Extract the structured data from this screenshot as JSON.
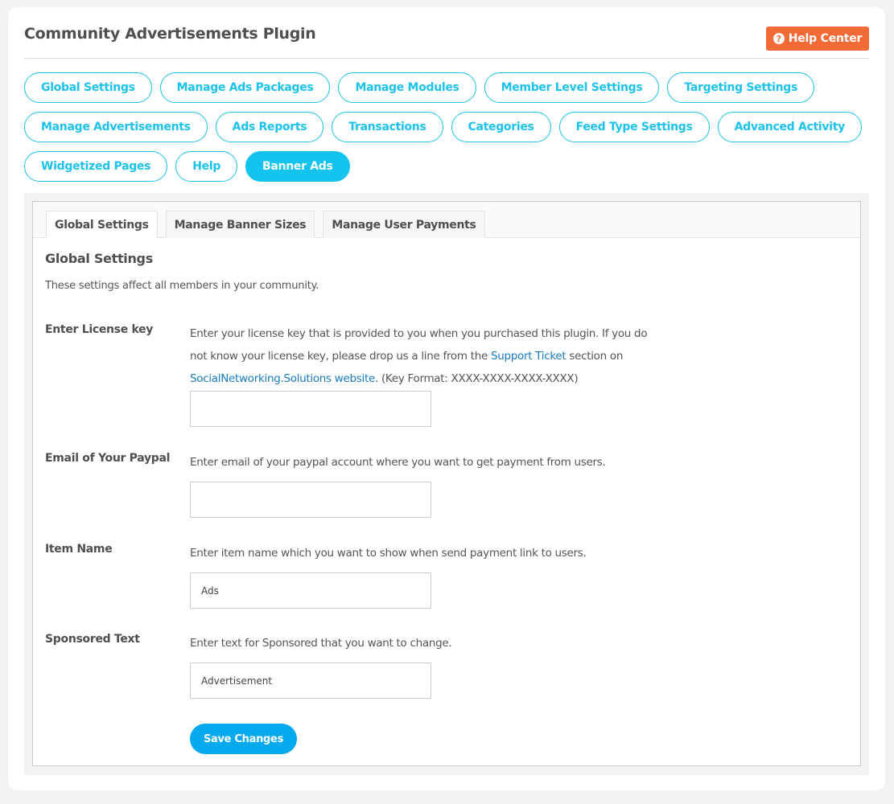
{
  "header": {
    "title": "Community Advertisements Plugin",
    "help_center_label": "Help Center",
    "help_center_icon": "question-circle-icon",
    "help_center_color": "#f26a35"
  },
  "nav": {
    "accent_color": "#1cc2eb",
    "rows": [
      [
        {
          "label": "Global Settings",
          "active": false
        },
        {
          "label": "Manage Ads Packages",
          "active": false
        },
        {
          "label": "Manage Modules",
          "active": false
        },
        {
          "label": "Member Level Settings",
          "active": false
        },
        {
          "label": "Targeting Settings",
          "active": false
        }
      ],
      [
        {
          "label": "Manage Advertisements",
          "active": false
        },
        {
          "label": "Ads Reports",
          "active": false
        },
        {
          "label": "Transactions",
          "active": false
        },
        {
          "label": "Categories",
          "active": false
        },
        {
          "label": "Feed Type Settings",
          "active": false
        },
        {
          "label": "Advanced Activity",
          "active": false
        }
      ],
      [
        {
          "label": "Widgetized Pages",
          "active": false
        },
        {
          "label": "Help",
          "active": false
        },
        {
          "label": "Banner Ads",
          "active": true
        }
      ]
    ]
  },
  "tabs": [
    {
      "label": "Global Settings",
      "active": true
    },
    {
      "label": "Manage Banner Sizes",
      "active": false
    },
    {
      "label": "Manage User Payments",
      "active": false
    }
  ],
  "section": {
    "title": "Global Settings",
    "description": "These settings affect all members in your community."
  },
  "fields": {
    "license": {
      "label": "Enter License key",
      "desc_part1": "Enter your license key that is provided to you when you purchased this plugin. If you do not know your license key, please drop us a line from the ",
      "link1": "Support Ticket",
      "desc_part2": " section on ",
      "link2": "SocialNetworking.Solutions website",
      "desc_part3": ". (Key Format: XXXX-XXXX-XXXX-XXXX)",
      "value": ""
    },
    "paypal": {
      "label": "Email of Your Paypal",
      "description": "Enter email of your paypal account where you want to get payment from users.",
      "value": ""
    },
    "item_name": {
      "label": "Item Name",
      "description": "Enter item name which you want to show when send payment link to users.",
      "value": "Ads"
    },
    "sponsored": {
      "label": "Sponsored Text",
      "description": "Enter text for Sponsored that you want to change.",
      "value": "Advertisement"
    }
  },
  "save_label": "Save Changes"
}
